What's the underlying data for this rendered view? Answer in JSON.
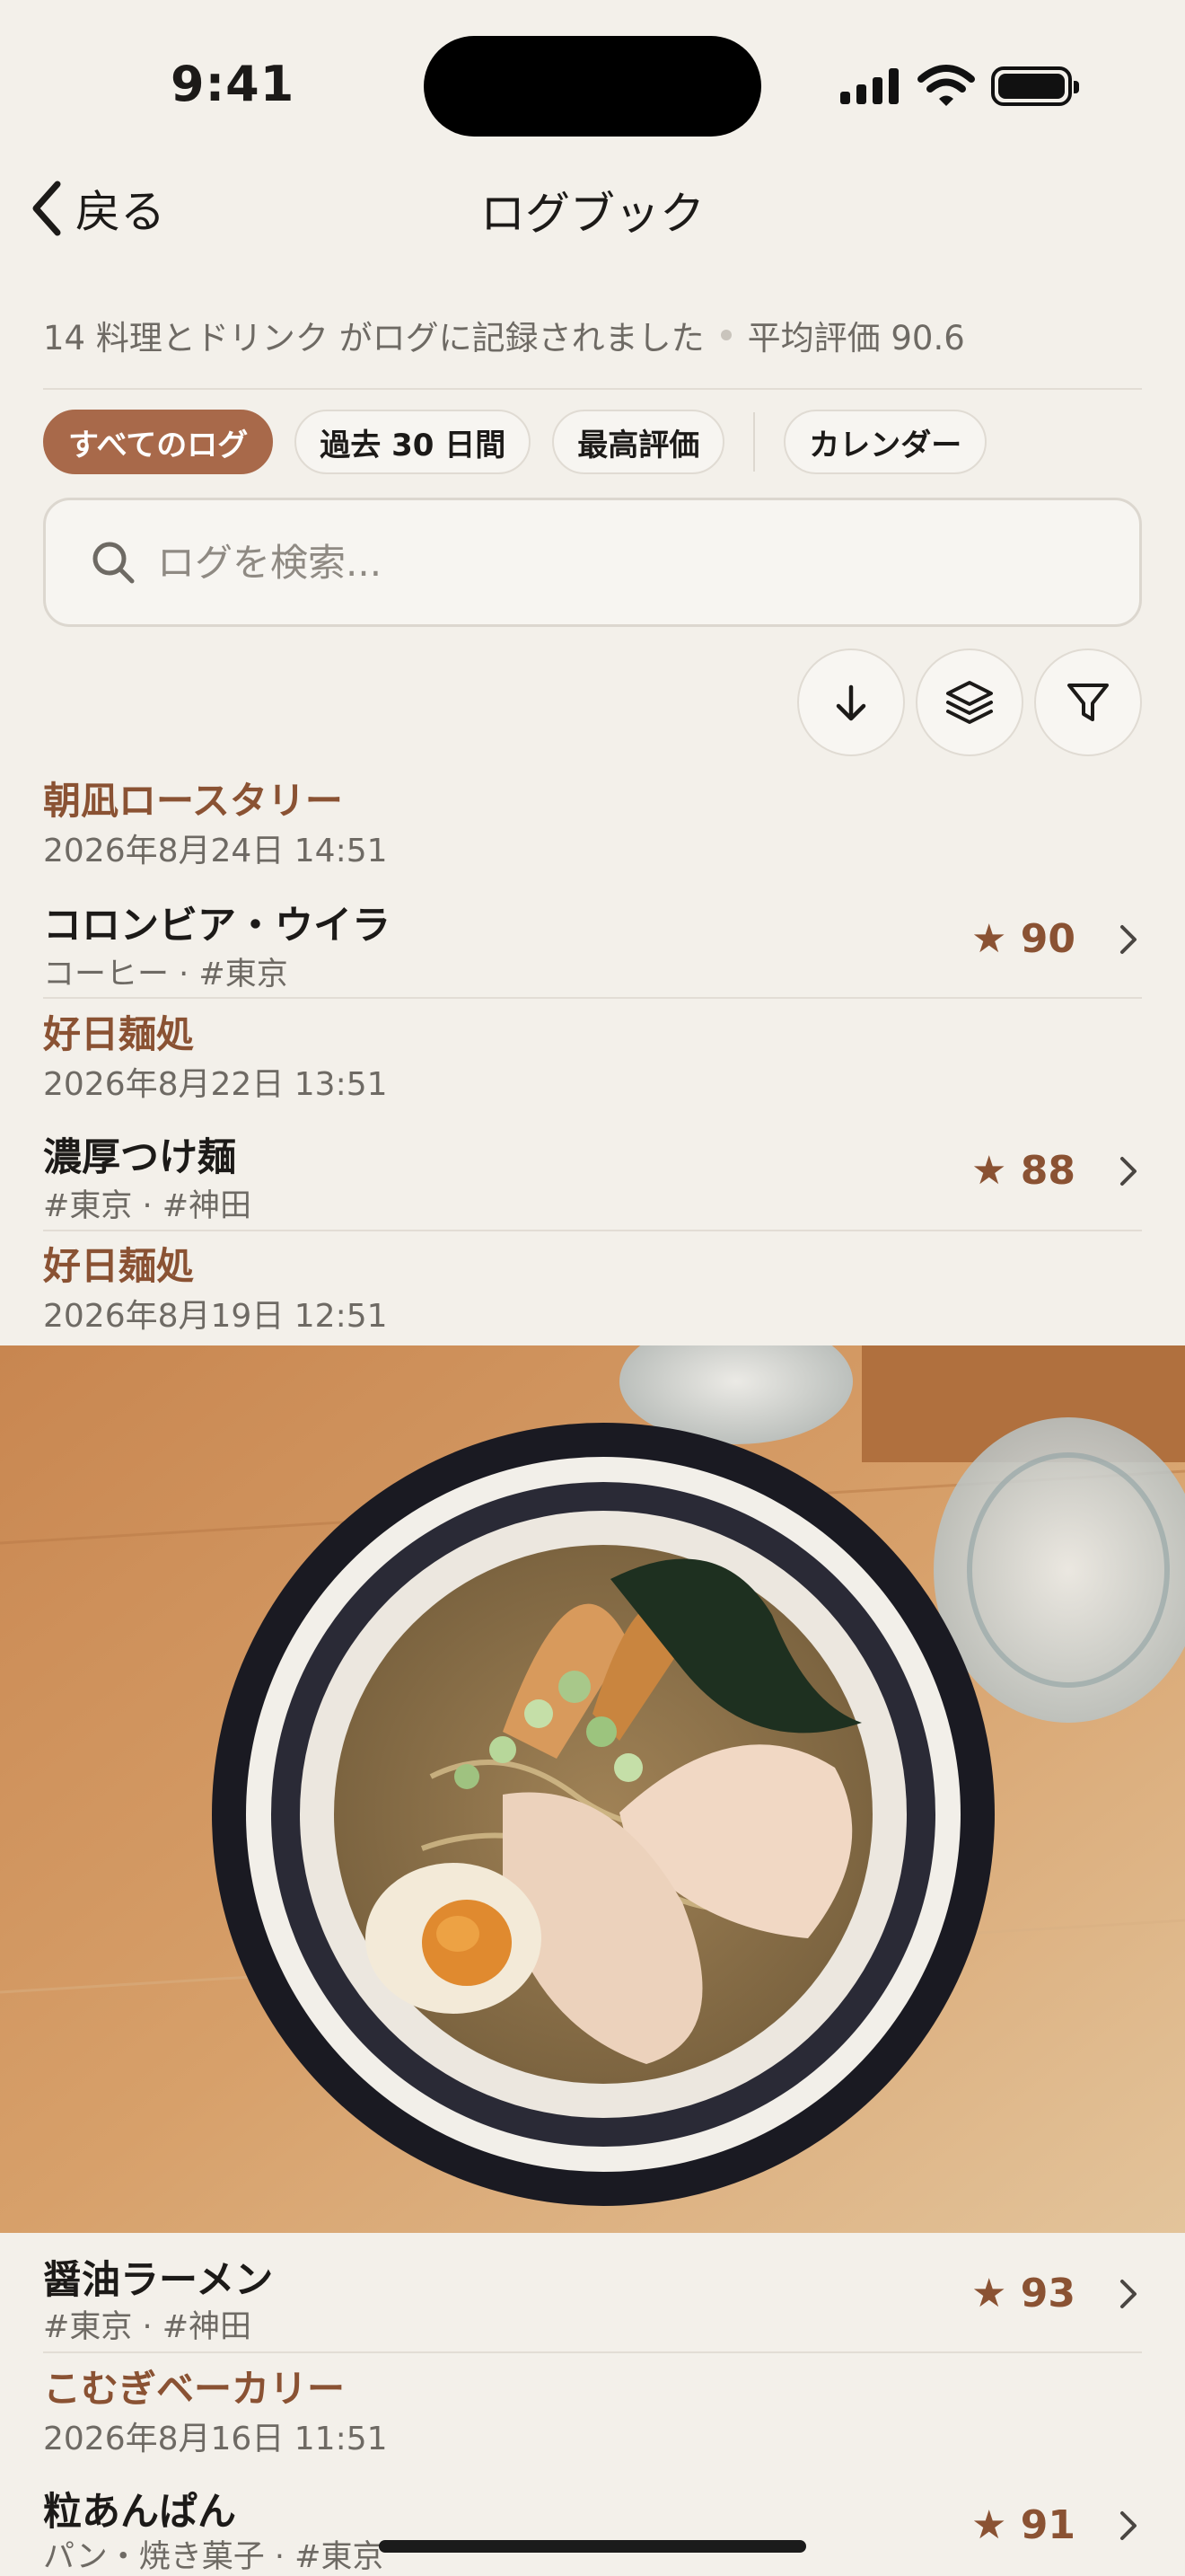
{
  "status": {
    "time": "9:41"
  },
  "nav": {
    "back_label": "戻る",
    "title": "ログブック"
  },
  "summary": {
    "count_text": "14 料理とドリンク がログに記録されました",
    "avg_text": "平均評価 90.6"
  },
  "filters": [
    {
      "label": "すべてのログ",
      "active": true
    },
    {
      "label": "過去 30 日間",
      "active": false
    },
    {
      "label": "最高評価",
      "active": false
    },
    {
      "label": "カレンダー",
      "active": false
    }
  ],
  "search": {
    "placeholder": "ログを検索..."
  },
  "icons": {
    "sort": "arrow-down-icon",
    "group": "layers-icon",
    "filter": "filter-icon"
  },
  "colors": {
    "accent": "#a8694a",
    "venue": "#8a5233",
    "background": "#f3f0ea"
  },
  "entries": [
    {
      "venue": "朝凪ロースタリー",
      "datetime": "2026年8月24日 14:51",
      "name": "コロンビア・ウイラ",
      "tags": "コーヒー · #東京",
      "score": "★ 90"
    },
    {
      "venue": "好日麺処",
      "datetime": "2026年8月22日 13:51",
      "name": "濃厚つけ麺",
      "tags": "#東京 · #神田",
      "score": "★ 88"
    },
    {
      "venue": "好日麺処",
      "datetime": "2026年8月19日 12:51",
      "name": "醤油ラーメン",
      "tags": "#東京 · #神田",
      "score": "★ 93",
      "has_photo": true
    },
    {
      "venue": "こむぎベーカリー",
      "datetime": "2026年8月16日 11:51",
      "name": "粒あんぱん",
      "tags": "パン・焼き菓子 · #東京",
      "score": "★ 91"
    }
  ]
}
